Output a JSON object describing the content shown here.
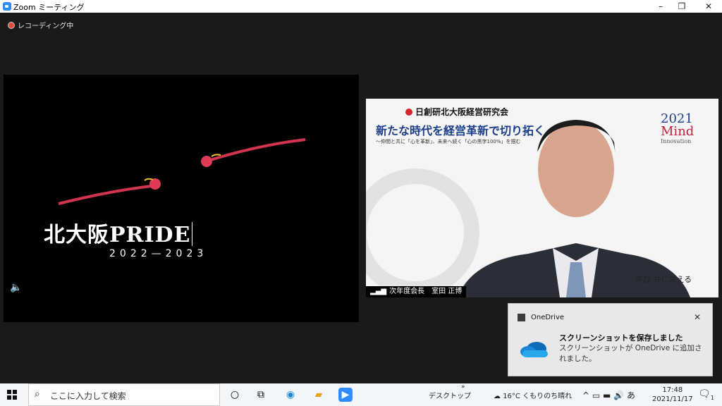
{
  "window": {
    "title": "Zoom ミーティング",
    "minimize": "–",
    "restore": "❐",
    "close": "✕"
  },
  "recording": {
    "label": "レコーディング中"
  },
  "share": {
    "title_text": "北大阪PRIDE",
    "years": "2022—2023",
    "speaker_icon": "speaker-icon"
  },
  "video": {
    "header": "日創研北大阪経営研究会",
    "slogan": "新たな時代を経営革新で切り拓く",
    "subslogan": "～仲間と共に「心を革新」、未来へ続く「心の黒字100%」を掴む",
    "badge_year": "2021",
    "badge_mind": "Mind",
    "badge_innovation": "Innovation",
    "footer": "学び 共に栄える",
    "name_tag": "次年度会長　室田 正博"
  },
  "toast": {
    "app": "OneDrive",
    "title": "スクリーンショットを保存しました",
    "body": "スクリーンショットが OneDrive に追加されました。"
  },
  "taskbar": {
    "search_placeholder": "ここに入力して検索",
    "desktop_label": "デスクトップ",
    "chevrons": "»",
    "weather": "16°C くもりのち晴れ",
    "ime": "あ",
    "time": "17:48",
    "date": "2021/11/17",
    "notification_count": "1"
  },
  "colors": {
    "zoom_blue": "#2d8cff",
    "recording_red": "#e0493f",
    "slogan_blue": "#1d3f8a"
  }
}
